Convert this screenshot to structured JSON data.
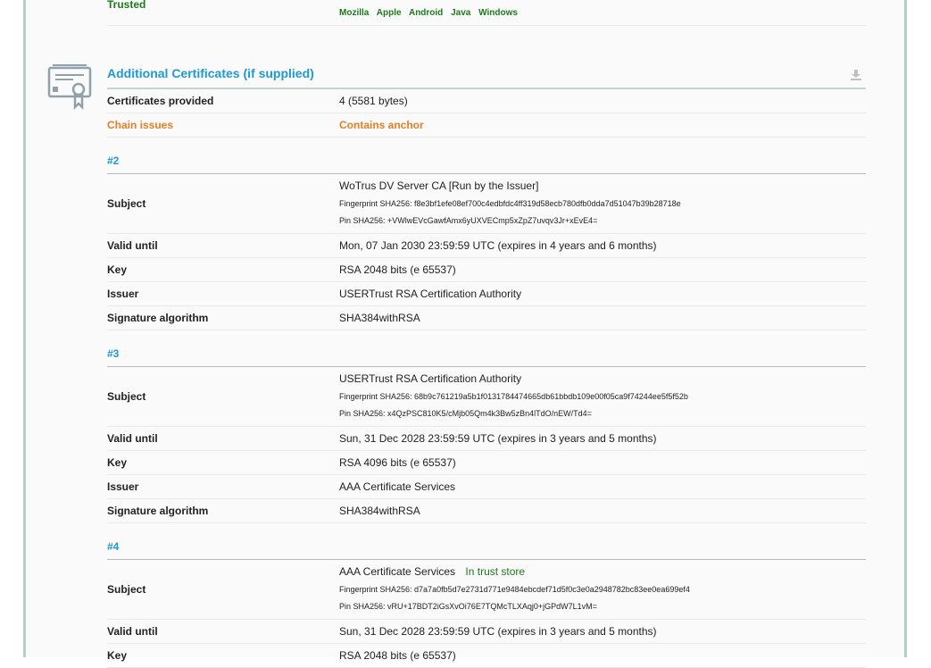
{
  "trusted": {
    "label": "Trusted",
    "stores": [
      "Mozilla",
      "Apple",
      "Android",
      "Java",
      "Windows"
    ]
  },
  "section": {
    "title": "Additional Certificates (if supplied)",
    "icon": "certificate-icon",
    "download_icon": "download-icon"
  },
  "summary": {
    "provided_label": "Certificates provided",
    "provided_value": "4 (5581 bytes)",
    "chain_label": "Chain issues",
    "chain_value": "Contains anchor"
  },
  "labels": {
    "subject": "Subject",
    "valid_until": "Valid until",
    "key": "Key",
    "issuer": "Issuer",
    "sig": "Signature algorithm"
  },
  "certs": [
    {
      "id": "#2",
      "subject": "WoTrus DV Server CA [Run by the Issuer]",
      "fingerprint": "Fingerprint SHA256: f8e3bf1efe08ef700c4edbfdc4ff319d58ecb780dfb0dda7d51047b39b28718e",
      "pin": "Pin SHA256: +VWlwEVcGawfAmx6yUXVECmp5xZpZ7uvqv3Jr+xEvE4=",
      "valid_until": "Mon, 07 Jan 2030 23:59:59 UTC (expires in 4 years and 6 months)",
      "key": "RSA 2048 bits (e 65537)",
      "issuer": "USERTrust RSA Certification Authority",
      "sig": "SHA384withRSA"
    },
    {
      "id": "#3",
      "subject": "USERTrust RSA Certification Authority",
      "fingerprint": "Fingerprint SHA256: 68b9c761219a5b1f0131784474665db61bbdb109e00f05ca9f74244ee5f5f52b",
      "pin": "Pin SHA256: x4QzPSC810K5/cMjb05Qm4k3Bw5zBn4lTdO/nEW/Td4=",
      "valid_until": "Sun, 31 Dec 2028 23:59:59 UTC (expires in 3 years and 5 months)",
      "key": "RSA 4096 bits (e 65537)",
      "issuer": "AAA Certificate Services",
      "sig": "SHA384withRSA"
    },
    {
      "id": "#4",
      "subject": "AAA Certificate Services",
      "trust_note": "In trust store",
      "fingerprint": "Fingerprint SHA256: d7a7a0fb5d7e2731d771e9484ebcdef71d5f0c3e0a2948782bc83ee0ea699ef4",
      "pin": "Pin SHA256: vRU+17BDT2iGsXvOi76E7TQMcTLXAqj0+jGPdW7L1vM=",
      "valid_until": "Sun, 31 Dec 2028 23:59:59 UTC (expires in 3 years and 5 months)",
      "key": "RSA 2048 bits (e 65537)"
    }
  ],
  "colors": {
    "link_blue": "#1c9ad6",
    "trust_green": "#1b7a1b",
    "warn_orange": "#e57f23"
  }
}
